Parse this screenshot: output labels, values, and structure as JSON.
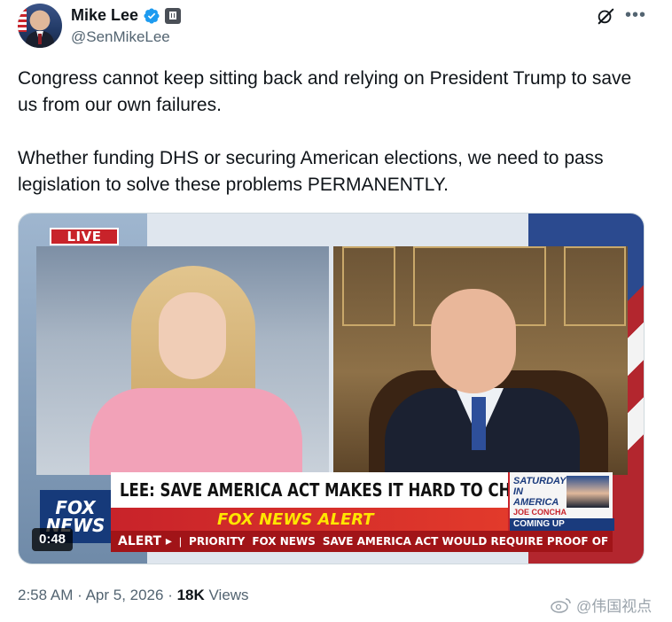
{
  "author": {
    "name": "Mike Lee",
    "handle": "@SenMikeLee"
  },
  "icons": {
    "verified": "verified-badge-icon",
    "government": "government-badge-icon",
    "grok": "grok-icon",
    "more": "more-options-icon"
  },
  "tweet": {
    "paragraphs": [
      "Congress cannot keep sitting back and relying on President Trump to save us from our own failures.",
      "Whether funding DHS or securing American elections, we need to pass legislation to solve these problems PERMANENTLY."
    ]
  },
  "media": {
    "live_label": "LIVE",
    "fox_logo_line1": "FOX",
    "fox_logo_line2": "NEWS",
    "headline": "LEE: SAVE AMERICA ACT MAKES IT HARD TO CHEAT",
    "alert_banner": "FOX NEWS ALERT",
    "show_title": "SATURDAY IN AMERICA",
    "show_guest": "JOE CONCHA",
    "show_coming": "COMING UP",
    "ticker_alert": "ALERT ▸",
    "ticker_priority": "PRIORITY",
    "ticker_fox": "FOX NEWS",
    "ticker_text": "SAVE AMERICA ACT WOULD REQUIRE PROOF OF CITIZEN",
    "duration": "0:48"
  },
  "footer": {
    "time": "2:58 AM",
    "date": "Apr 5, 2026",
    "views_count": "18K",
    "views_label": "Views",
    "watermark": "@伟国视点"
  },
  "colors": {
    "text_primary": "#0f1419",
    "text_secondary": "#536471",
    "verified_blue": "#1d9bf0",
    "fox_red": "#c8232a"
  }
}
